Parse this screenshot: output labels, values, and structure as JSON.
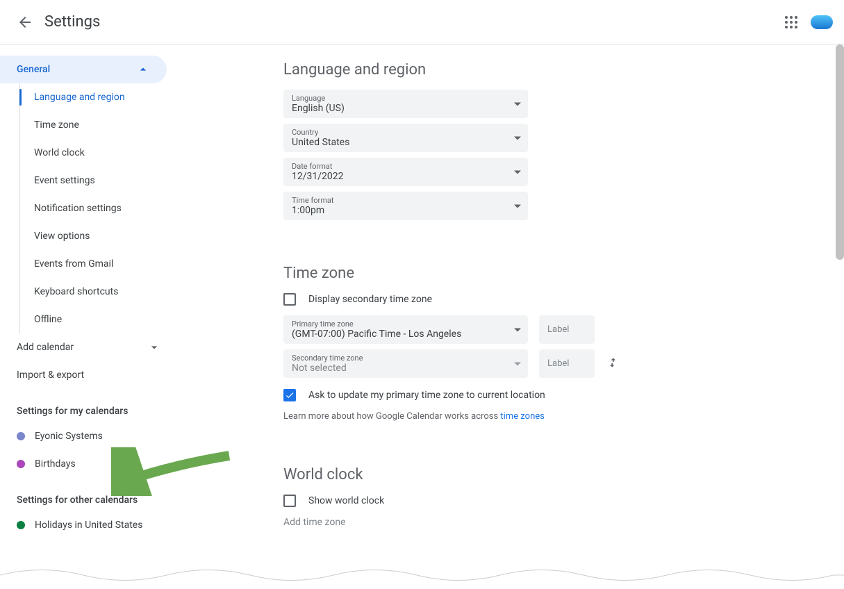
{
  "header": {
    "title": "Settings"
  },
  "sidebar": {
    "general": {
      "label": "General",
      "items": [
        "Language and region",
        "Time zone",
        "World clock",
        "Event settings",
        "Notification settings",
        "View options",
        "Events from Gmail",
        "Keyboard shortcuts",
        "Offline"
      ]
    },
    "add_calendar": "Add calendar",
    "import_export": "Import & export",
    "my_calendars_heading": "Settings for my calendars",
    "my_calendars": [
      {
        "name": "Eyonic Systems",
        "color": "#7986cb"
      },
      {
        "name": "Birthdays",
        "color": "#ab47bc"
      }
    ],
    "other_calendars_heading": "Settings for other calendars",
    "other_calendars": [
      {
        "name": "Holidays in United States",
        "color": "#0b8043"
      }
    ]
  },
  "content": {
    "language_region": {
      "title": "Language and region",
      "fields": {
        "language": {
          "label": "Language",
          "value": "English (US)"
        },
        "country": {
          "label": "Country",
          "value": "United States"
        },
        "date_format": {
          "label": "Date format",
          "value": "12/31/2022"
        },
        "time_format": {
          "label": "Time format",
          "value": "1:00pm"
        }
      }
    },
    "time_zone": {
      "title": "Time zone",
      "display_secondary": "Display secondary time zone",
      "primary": {
        "label": "Primary time zone",
        "value": "(GMT-07:00) Pacific Time - Los Angeles"
      },
      "secondary": {
        "label": "Secondary time zone",
        "value": "Not selected"
      },
      "label_placeholder": "Label",
      "ask_update": "Ask to update my primary time zone to current location",
      "help_prefix": "Learn more about how Google Calendar works across ",
      "help_link": "time zones"
    },
    "world_clock": {
      "title": "World clock",
      "show": "Show world clock",
      "add": "Add time zone"
    }
  }
}
